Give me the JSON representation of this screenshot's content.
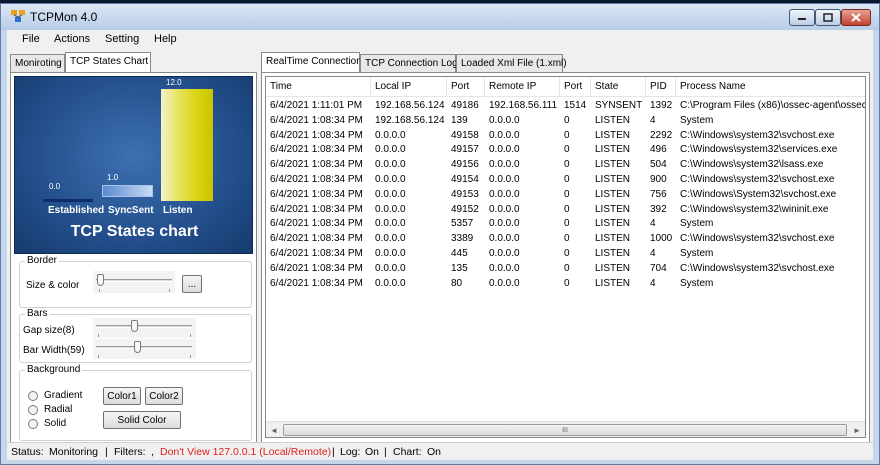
{
  "window": {
    "title": "TCPMon 4.0"
  },
  "menu": [
    "File",
    "Actions",
    "Setting",
    "Help"
  ],
  "left_tabs": [
    "Moniroting",
    "TCP States Chart"
  ],
  "right_tabs": [
    "RealTime Connection",
    "TCP Connection Log",
    "Loaded Xml File (1.xml)"
  ],
  "chart": {
    "title": "TCP States chart",
    "bars": [
      {
        "category": "Established",
        "value_label": "0.0"
      },
      {
        "category": "SyncSent",
        "value_label": "1.0"
      },
      {
        "category": "Listen",
        "value_label": "12.0"
      }
    ]
  },
  "chart_data": {
    "type": "bar",
    "title": "TCP States chart",
    "categories": [
      "Established",
      "SyncSent",
      "Listen"
    ],
    "values": [
      0.0,
      1.0,
      12.0
    ],
    "colors": [
      "#0f2d6a",
      "#8fb3e2",
      "#d9d40e"
    ]
  },
  "border_group": {
    "title": "Border",
    "size_color_label": "Size & color",
    "ellipsis_button": "..."
  },
  "bars_group": {
    "title": "Bars",
    "gap_label": "Gap size(8)",
    "width_label": "Bar Width(59)",
    "gap_value": 8,
    "width_value": 59
  },
  "background_group": {
    "title": "Background",
    "options": [
      "Gradient",
      "Radial",
      "Solid"
    ],
    "color1": "Color1",
    "color2": "Color2",
    "solid_color": "Solid Color"
  },
  "table": {
    "columns": [
      "Time",
      "Local IP",
      "Port",
      "Remote IP",
      "Port",
      "State",
      "PID",
      "Process Name"
    ],
    "rows": [
      [
        "6/4/2021 1:11:01 PM",
        "192.168.56.124",
        "49186",
        "192.168.56.111",
        "1514",
        "SYNSENT",
        "1392",
        "C:\\Program Files (x86)\\ossec-agent\\ossec-a"
      ],
      [
        "6/4/2021 1:08:34 PM",
        "192.168.56.124",
        "139",
        "0.0.0.0",
        "0",
        "LISTEN",
        "4",
        "System"
      ],
      [
        "6/4/2021 1:08:34 PM",
        "0.0.0.0",
        "49158",
        "0.0.0.0",
        "0",
        "LISTEN",
        "2292",
        "C:\\Windows\\system32\\svchost.exe"
      ],
      [
        "6/4/2021 1:08:34 PM",
        "0.0.0.0",
        "49157",
        "0.0.0.0",
        "0",
        "LISTEN",
        "496",
        "C:\\Windows\\system32\\services.exe"
      ],
      [
        "6/4/2021 1:08:34 PM",
        "0.0.0.0",
        "49156",
        "0.0.0.0",
        "0",
        "LISTEN",
        "504",
        "C:\\Windows\\system32\\lsass.exe"
      ],
      [
        "6/4/2021 1:08:34 PM",
        "0.0.0.0",
        "49154",
        "0.0.0.0",
        "0",
        "LISTEN",
        "900",
        "C:\\Windows\\system32\\svchost.exe"
      ],
      [
        "6/4/2021 1:08:34 PM",
        "0.0.0.0",
        "49153",
        "0.0.0.0",
        "0",
        "LISTEN",
        "756",
        "C:\\Windows\\System32\\svchost.exe"
      ],
      [
        "6/4/2021 1:08:34 PM",
        "0.0.0.0",
        "49152",
        "0.0.0.0",
        "0",
        "LISTEN",
        "392",
        "C:\\Windows\\system32\\wininit.exe"
      ],
      [
        "6/4/2021 1:08:34 PM",
        "0.0.0.0",
        "5357",
        "0.0.0.0",
        "0",
        "LISTEN",
        "4",
        "System"
      ],
      [
        "6/4/2021 1:08:34 PM",
        "0.0.0.0",
        "3389",
        "0.0.0.0",
        "0",
        "LISTEN",
        "1000",
        "C:\\Windows\\system32\\svchost.exe"
      ],
      [
        "6/4/2021 1:08:34 PM",
        "0.0.0.0",
        "445",
        "0.0.0.0",
        "0",
        "LISTEN",
        "4",
        "System"
      ],
      [
        "6/4/2021 1:08:34 PM",
        "0.0.0.0",
        "135",
        "0.0.0.0",
        "0",
        "LISTEN",
        "704",
        "C:\\Windows\\system32\\svchost.exe"
      ],
      [
        "6/4/2021 1:08:34 PM",
        "0.0.0.0",
        "80",
        "0.0.0.0",
        "0",
        "LISTEN",
        "4",
        "System"
      ]
    ]
  },
  "scroll_grip": "III",
  "status": {
    "status_label": "Status:",
    "status_value": "Monitoring",
    "sep": "|",
    "filters_label": "Filters:",
    "filters_comma": ",",
    "filters_value": "Don't View 127.0.0.1 (Local/Remote)",
    "log_label": "Log:",
    "log_value": "On",
    "chart_label": "Chart:",
    "chart_value": "On"
  }
}
